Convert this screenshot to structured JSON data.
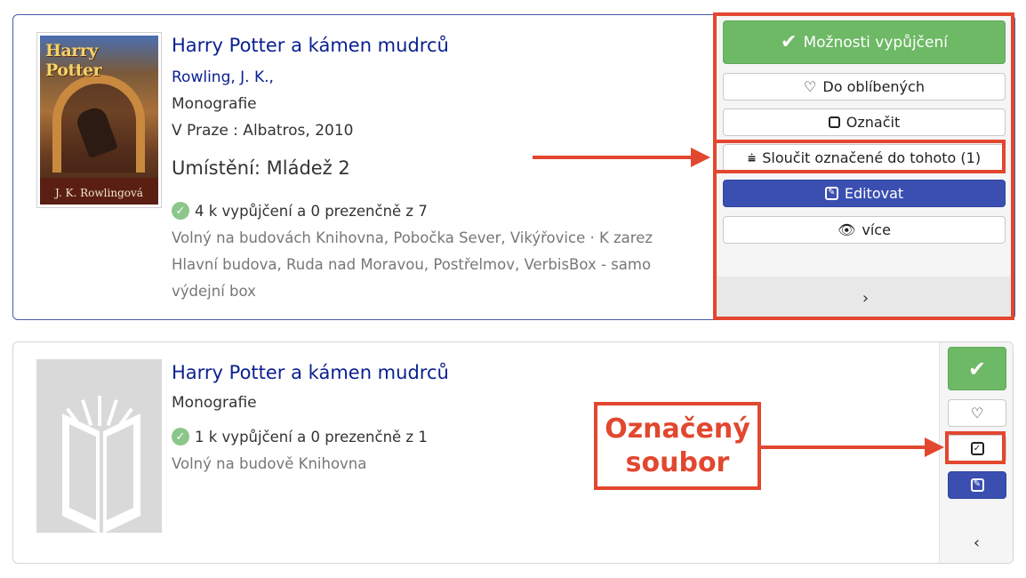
{
  "records": [
    {
      "title": "Harry Potter a kámen mudrců",
      "author": "Rowling, J. K.,",
      "type": "Monografie",
      "publisher": "V Praze : Albatros, 2010",
      "location": "Umístění: Mládež 2",
      "availability": "4 k vypůjčení a 0 prezenčně z 7",
      "detail_lines": [
        "Volný na budovách Knihovna, Pobočka Sever, Vikýřovice · K zarez",
        "Hlavní budova, Ruda nad Moravou, Postřelmov, VerbisBox - samo",
        "výdejní box"
      ],
      "cover": {
        "title_text": "Harry Potter",
        "author_text": "J. K. Rowlingová"
      },
      "actions": {
        "borrow": "Možnosti vypůjčení",
        "favorite": "Do oblíbených",
        "mark": "Označit",
        "merge": "Sloučit označené do tohoto (1)",
        "edit": "Editovat",
        "more": "více"
      },
      "footer_icon": "chevron-right-icon"
    },
    {
      "title": "Harry Potter a kámen mudrců",
      "type": "Monografie",
      "availability": "1 k vypůjčení a 0 prezenčně z 1",
      "detail_lines": [
        "Volný na budově Knihovna"
      ],
      "cover": {
        "placeholder_icon": "book-icon"
      },
      "actions": {
        "borrow_icon": "check-icon",
        "favorite_icon": "heart-icon",
        "marked_icon": "checked-box-icon",
        "edit_icon": "edit-icon"
      },
      "footer_icon": "chevron-left-icon"
    }
  ],
  "annotations": {
    "marked_label_line1": "Označený",
    "marked_label_line2": "soubor",
    "color": "#e2472f"
  },
  "colors": {
    "link": "#0a1f8f",
    "green": "#6db965",
    "blue": "#3a4fb0"
  }
}
